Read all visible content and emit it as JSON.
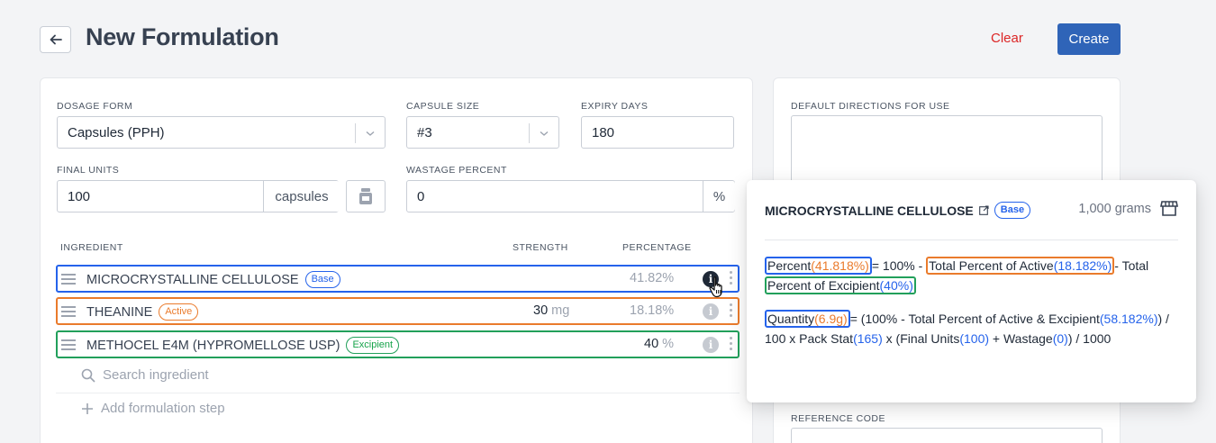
{
  "header": {
    "title": "New Formulation",
    "clear_label": "Clear",
    "create_label": "Create"
  },
  "form": {
    "dosage_form": {
      "label": "DOSAGE FORM",
      "value": "Capsules (PPH)"
    },
    "capsule_size": {
      "label": "CAPSULE SIZE",
      "value": "#3"
    },
    "expiry_days": {
      "label": "EXPIRY DAYS",
      "value": "180"
    },
    "final_units": {
      "label": "FINAL UNITS",
      "value": "100",
      "suffix": "capsules"
    },
    "wastage_percent": {
      "label": "WASTAGE PERCENT",
      "value": "0",
      "suffix": "%"
    }
  },
  "ingredients": {
    "headers": {
      "ingredient": "INGREDIENT",
      "strength": "STRENGTH",
      "percentage": "PERCENTAGE"
    },
    "rows": [
      {
        "name": "MICROCRYSTALLINE CELLULOSE",
        "badge": "Base",
        "strength": "",
        "strength_unit": "",
        "percentage": "41.82%"
      },
      {
        "name": "THEANINE",
        "badge": "Active",
        "strength": "30",
        "strength_unit": "mg",
        "percentage": "18.18%"
      },
      {
        "name": "METHOCEL E4M (HYPROMELLOSE USP)",
        "badge": "Excipient",
        "strength": "40",
        "strength_unit": "%",
        "percentage": ""
      }
    ],
    "search_placeholder": "Search ingredient",
    "add_step_label": "Add formulation step"
  },
  "right_panel": {
    "directions_label": "DEFAULT DIRECTIONS FOR USE",
    "reference_code_label": "REFERENCE CODE"
  },
  "popover": {
    "title": "MICROCRYSTALLINE CELLULOSE",
    "badge": "Base",
    "amount": "1,000 grams",
    "percent_formula": {
      "lhs": "Percent",
      "lhs_value": "(41.818%)",
      "eq": "= 100% -",
      "active_label": "Total Percent of Active",
      "active_value": "(18.182%)",
      "minus": "- Total",
      "excipient_label": "Percent of Excipient",
      "excipient_value": "(40%)"
    },
    "quantity_formula": {
      "lhs": "Quantity",
      "lhs_value": "(6.9g)",
      "part1": "= (100% - Total Percent of Active & Excipient",
      "excipient_value": "(58.182%)",
      "part2": ") / 100 x Pack Stat",
      "pack_stat": "(165)",
      "part3": " x (Final Units",
      "final_units": "(100)",
      "part4": " + Wastage",
      "wastage": "(0)",
      "part5": ") / 1000"
    }
  },
  "colors": {
    "primary": "#2f64b8",
    "danger": "#dc2626",
    "base": "#2563eb",
    "active": "#ea7b2c",
    "excipient": "#22a05b"
  }
}
